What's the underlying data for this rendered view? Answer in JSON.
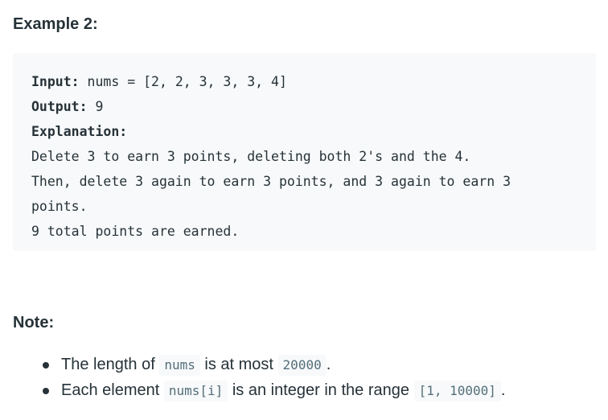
{
  "example": {
    "heading": "Example 2:",
    "input_label": "Input:",
    "input_value": " nums = [2, 2, 3, 3, 3, 4]",
    "output_label": "Output:",
    "output_value": " 9",
    "explanation_label": "Explanation:",
    "explanation_lines": [
      "Delete 3 to earn 3 points, deleting both 2's and the 4.",
      "Then, delete 3 again to earn 3 points, and 3 again to earn 3",
      "points.",
      "9 total points are earned."
    ]
  },
  "note": {
    "heading": "Note:",
    "items": [
      {
        "before": "The length of ",
        "code": "nums",
        "middle": " is at most ",
        "code2": "20000",
        "after": "."
      },
      {
        "before": "Each element ",
        "code": "nums[i]",
        "middle": " is an integer in the range ",
        "code2": "[1, 10000]",
        "after": "."
      }
    ]
  }
}
